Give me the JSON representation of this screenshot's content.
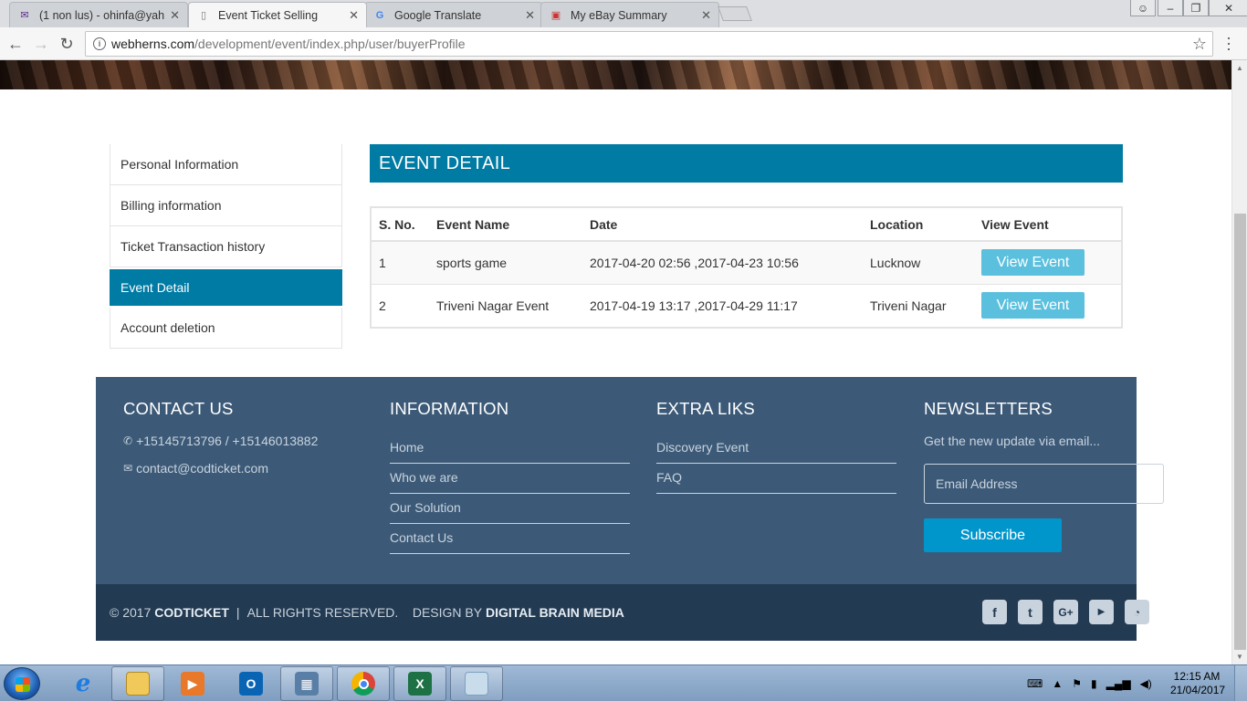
{
  "browser": {
    "tabs": [
      {
        "title": "(1 non lus) - ohinfa@yah",
        "active": false
      },
      {
        "title": "Event Ticket Selling",
        "active": true
      },
      {
        "title": "Google Translate",
        "active": false
      },
      {
        "title": "My eBay Summary",
        "active": false
      }
    ],
    "url_domain": "webherns.com",
    "url_path": "/development/event/index.php/user/buyerProfile"
  },
  "sidebar": {
    "items": [
      {
        "label": "Personal Information"
      },
      {
        "label": "Billing information"
      },
      {
        "label": "Ticket Transaction history"
      },
      {
        "label": "Event Detail"
      },
      {
        "label": "Account deletion"
      }
    ],
    "active_index": 3
  },
  "main": {
    "title": "EVENT DETAIL",
    "columns": [
      "S. No.",
      "Event Name",
      "Date",
      "Location",
      "View Event"
    ],
    "rows": [
      {
        "sno": "1",
        "name": "sports game",
        "date": "2017-04-20 02:56 ,2017-04-23 10:56",
        "location": "Lucknow",
        "action": "View Event"
      },
      {
        "sno": "2",
        "name": "Triveni Nagar Event",
        "date": "2017-04-19 13:17 ,2017-04-29 11:17",
        "location": "Triveni Nagar",
        "action": "View Event"
      }
    ]
  },
  "footer": {
    "contact": {
      "heading": "CONTACT US",
      "phone": "+15145713796 / +15146013882",
      "email": "contact@codticket.com"
    },
    "information": {
      "heading": "INFORMATION",
      "links": [
        "Home",
        "Who we are",
        "Our Solution",
        "Contact Us"
      ]
    },
    "extra": {
      "heading": "EXTRA LIKS",
      "links": [
        "Discovery Event",
        "FAQ"
      ]
    },
    "newsletter": {
      "heading": "NEWSLETTERS",
      "text": "Get the new update via email...",
      "placeholder": "Email Address",
      "button": "Subscribe"
    },
    "bottom": {
      "copyright_prefix": "© 2017",
      "brand": "CODTICKET",
      "rights": "ALL RIGHTS RESERVED.",
      "design_prefix": "DESIGN BY",
      "designer": "DIGITAL BRAIN MEDIA"
    },
    "social_icons": [
      "facebook-icon",
      "twitter-icon",
      "google-plus-icon",
      "youtube-icon",
      "rss-icon"
    ]
  },
  "taskbar": {
    "time": "12:15 AM",
    "date": "21/04/2017"
  },
  "colors": {
    "accent": "#007ba4",
    "footer_bg": "#3c5a78",
    "footer_bottom_bg": "#223a52",
    "button_info": "#5bc0de",
    "subscribe": "#0096cc"
  }
}
